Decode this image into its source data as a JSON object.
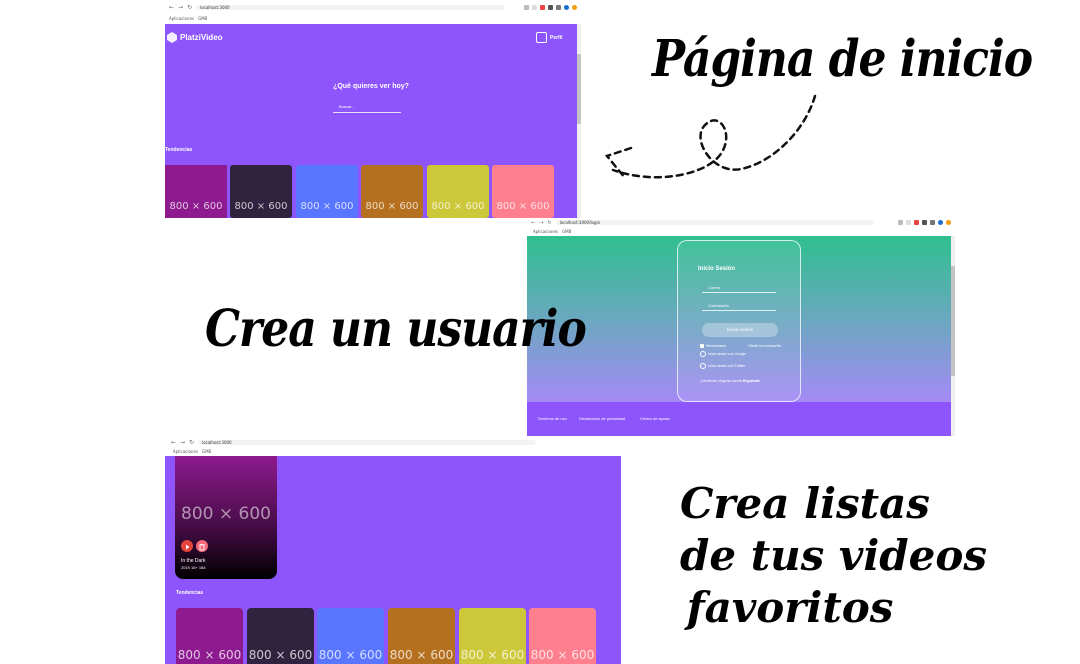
{
  "home_screen": {
    "url": "localhost:3000",
    "bookmarks": [
      "Aplicaciones",
      "GMB"
    ],
    "logo_text": "PlatziVideo",
    "profile_label": "Perfil",
    "hero_title": "¿Qué quieres ver hoy?",
    "search_placeholder": "Buscar...",
    "section_title": "Tendencias",
    "thumb_label": "800 × 600",
    "thumb_colors": [
      "#8d1a8e",
      "#2f2340",
      "#5876ff",
      "#b5701f",
      "#cdc73a",
      "#fe7f8e"
    ],
    "bg_color": "#8f55fd"
  },
  "login_screen": {
    "url": "localhost:3000/login",
    "bookmarks": [
      "Aplicaciones",
      "GMB"
    ],
    "title": "Inicio Sesión",
    "email_placeholder": "Correo",
    "password_placeholder": "Contraseña",
    "submit_label": "Iniciar sesión",
    "remember_label": "Recuérdame",
    "forgot_label": "Olvidé mi contraseña",
    "google_label": "Inicia sesión con Google",
    "twitter_label": "Inicia sesión con Twitter",
    "register_prompt": "¿No tienes ninguna cuenta",
    "register_link": "Regístrate",
    "footer_links": [
      "Términos de uso",
      "Declaración de privacidad",
      "Centro de ayuda"
    ],
    "gradient_top": "#2fbf8f",
    "gradient_bottom": "#a58af6"
  },
  "list_screen": {
    "url": "localhost:3000",
    "bookmarks": [
      "Aplicaciones",
      "GMB"
    ],
    "featured_label": "800 × 600",
    "featured_title": "In the Dark",
    "featured_meta": "2019 16+ 184",
    "section_title": "Tendencias",
    "thumb_label": "800 × 600",
    "thumb_colors": [
      "#8d1a8e",
      "#2f2340",
      "#5876ff",
      "#b5701f",
      "#cdc73a",
      "#fe7f8e"
    ]
  },
  "captions": {
    "home": "Página de inicio",
    "user": "Crea un usuario",
    "lists": [
      "Crea listas",
      "de tus videos",
      "favoritos"
    ]
  }
}
